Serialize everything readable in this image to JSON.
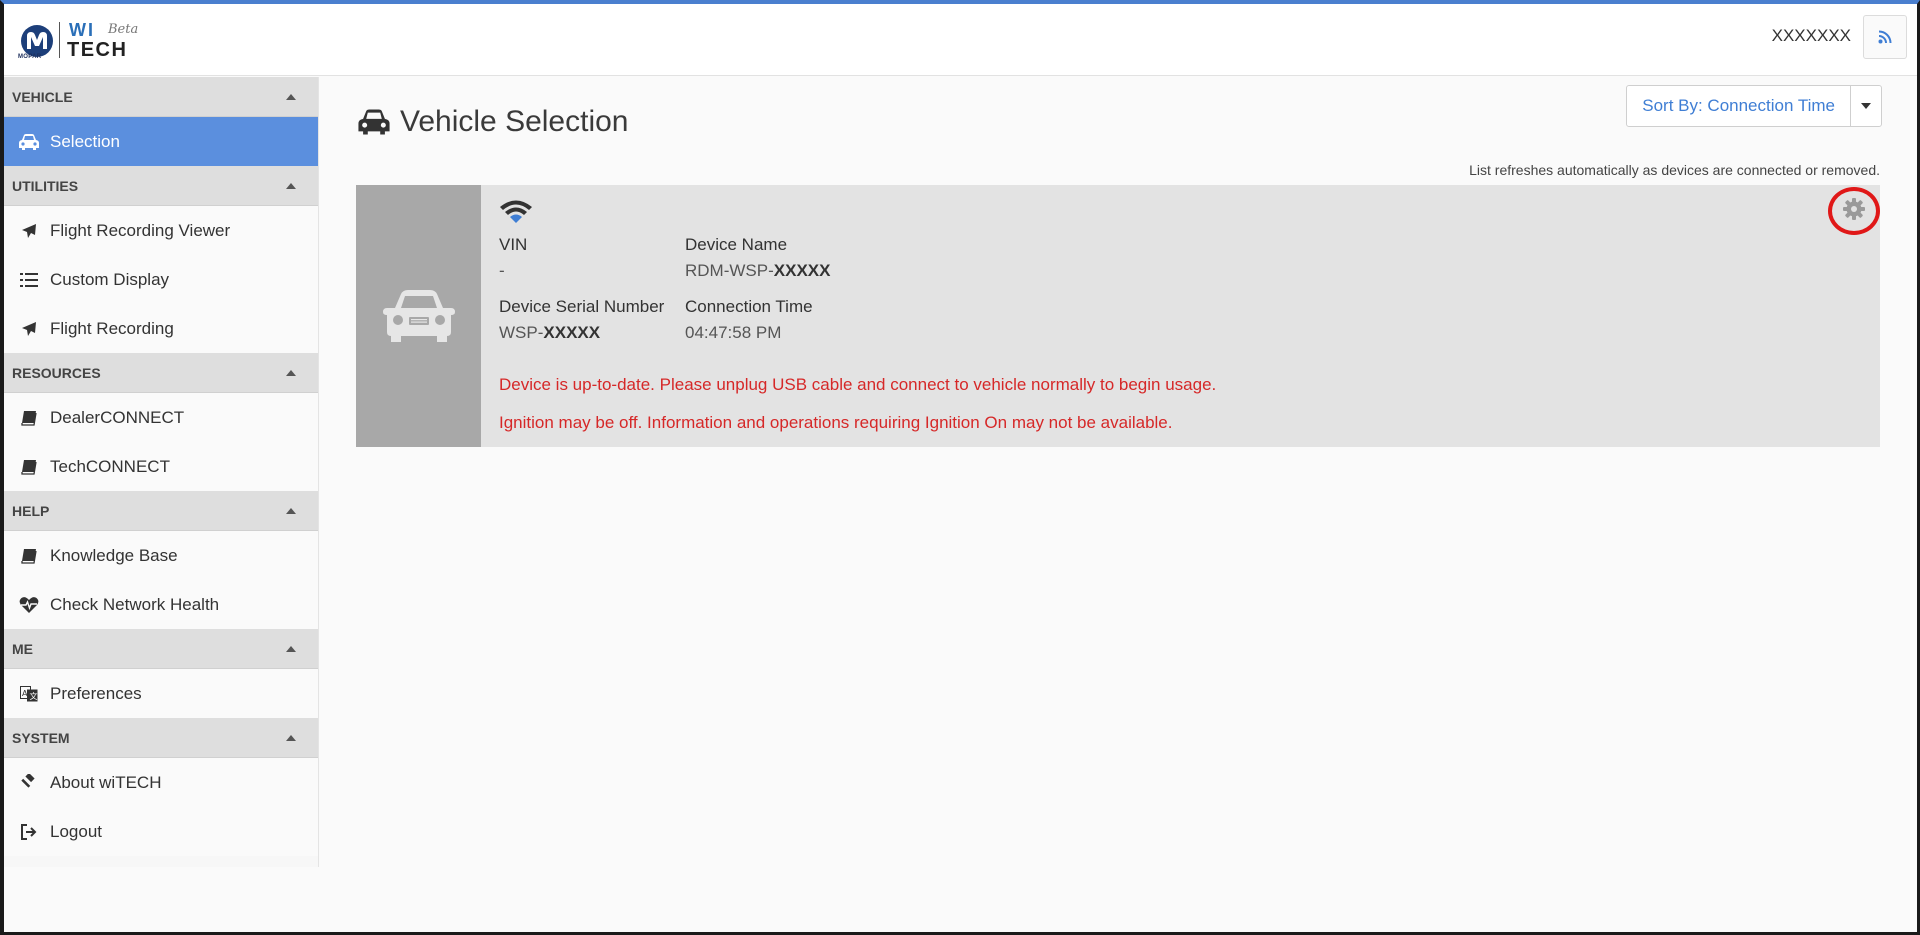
{
  "header": {
    "logo": {
      "brand": "MOPAR",
      "wi": "WI",
      "tech": "TECH",
      "beta": "Beta"
    },
    "user_name": "XXXXXXX",
    "rss_icon": "rss-icon"
  },
  "sidebar": {
    "sections": [
      {
        "title": "VEHICLE",
        "items": [
          {
            "label": "Selection",
            "icon": "car-icon",
            "active": true
          }
        ]
      },
      {
        "title": "UTILITIES",
        "items": [
          {
            "label": "Flight Recording Viewer",
            "icon": "plane-icon"
          },
          {
            "label": "Custom Display",
            "icon": "list-icon"
          },
          {
            "label": "Flight Recording",
            "icon": "plane-icon"
          }
        ]
      },
      {
        "title": "RESOURCES",
        "items": [
          {
            "label": "DealerCONNECT",
            "icon": "book-icon"
          },
          {
            "label": "TechCONNECT",
            "icon": "book-icon"
          }
        ]
      },
      {
        "title": "HELP",
        "items": [
          {
            "label": "Knowledge Base",
            "icon": "book-icon"
          },
          {
            "label": "Check Network Health",
            "icon": "heartbeat-icon"
          }
        ]
      },
      {
        "title": "ME",
        "items": [
          {
            "label": "Preferences",
            "icon": "translate-icon"
          }
        ]
      },
      {
        "title": "SYSTEM",
        "items": [
          {
            "label": "About wiTECH",
            "icon": "gavel-icon"
          },
          {
            "label": "Logout",
            "icon": "sign-out-icon"
          }
        ]
      }
    ]
  },
  "main": {
    "title": "Vehicle Selection",
    "sort_label": "Sort By: Connection Time",
    "refresh_note": "List refreshes automatically as devices are connected or removed.",
    "device": {
      "vin_label": "VIN",
      "vin_value": "-",
      "device_name_label": "Device Name",
      "device_name_prefix": "RDM-WSP-",
      "device_name_suffix": "XXXXX",
      "serial_label": "Device Serial Number",
      "serial_prefix": "WSP-",
      "serial_suffix": "XXXXX",
      "connection_time_label": "Connection Time",
      "connection_time_value": "04:47:58 PM",
      "warning_1": "Device is up-to-date. Please unplug USB cable and connect to vehicle normally to begin usage.",
      "warning_2": "Ignition may be off. Information and operations requiring Ignition On may not be available."
    }
  },
  "colors": {
    "accent": "#5b8fde",
    "link": "#3f7ed4",
    "warning": "#d62828",
    "highlight": "#e01818"
  }
}
